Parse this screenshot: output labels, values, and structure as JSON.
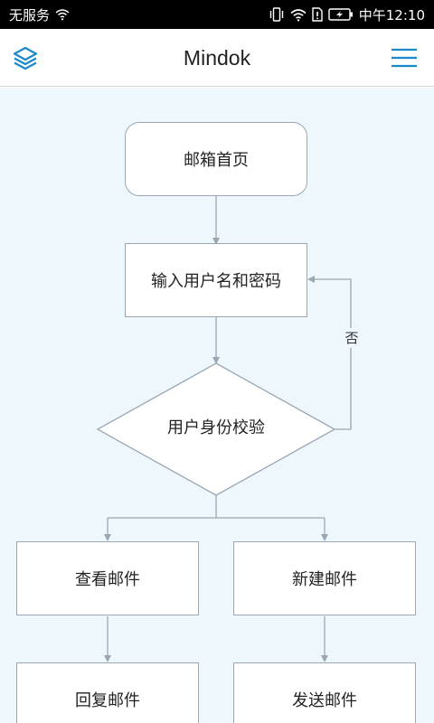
{
  "status_bar": {
    "carrier": "无服务",
    "time": "中午12:10"
  },
  "app_bar": {
    "title": "Mindok",
    "left_icon": "layers-icon",
    "right_icon": "menu-icon",
    "accent_color": "#1a88c9"
  },
  "flowchart": {
    "nodes": {
      "inbox_home": "邮箱首页",
      "enter_credentials": "输入用户名和密码",
      "verify_identity": "用户身份校验",
      "view_mail": "查看邮件",
      "new_mail": "新建邮件",
      "reply_mail": "回复邮件",
      "send_mail": "发送邮件"
    },
    "edge_labels": {
      "no": "否"
    },
    "colors": {
      "background": "#eef7fb",
      "node_border": "#9aa7b4",
      "connector": "#9aa7b4"
    }
  }
}
